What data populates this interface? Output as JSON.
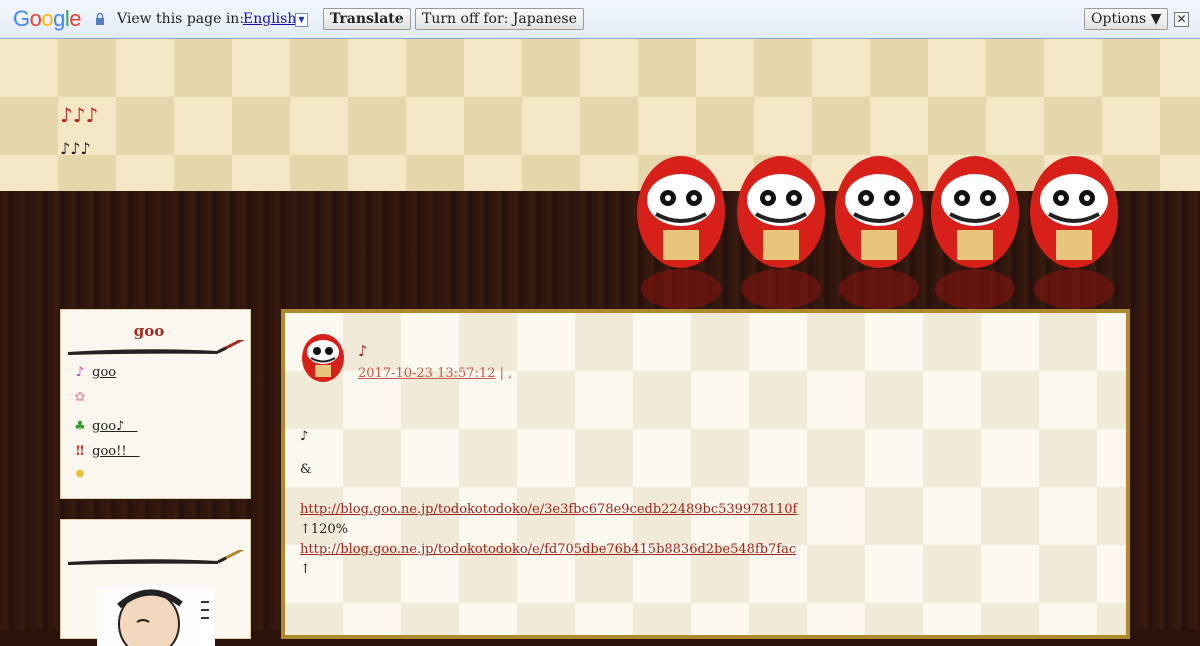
{
  "translate_bar": {
    "logo": "Google",
    "view_label": "View this page in:",
    "language": "English",
    "language_caret": "▼",
    "translate_button": "Translate",
    "turnoff_button": "Turn off for: Japanese",
    "options_button": "Options ▼",
    "close_button": "✕"
  },
  "header": {
    "title": "♪♪♪",
    "subtitle": "♪♪♪"
  },
  "sidebar": {
    "box1": {
      "title": "goo",
      "items": [
        {
          "icon": "♪",
          "label": "goo"
        },
        {
          "icon": "✿",
          "label": ""
        },
        {
          "icon": "♣",
          "label": "goo♪　"
        },
        {
          "icon": "‼",
          "label": "goo!!　"
        },
        {
          "icon": "●",
          "label": ""
        }
      ]
    }
  },
  "post": {
    "title": "♪",
    "date": "2017-10-23 13:57:12",
    "meta_sep": "| ,",
    "lines": [
      {
        "text": "♪"
      },
      {
        "text": "&"
      },
      {
        "text": "http://blog.goo.ne.jp/todokotodoko/e/3e3fbc678e9cedb22489bc539978110f"
      },
      {
        "text": "↑120%"
      },
      {
        "text": "http://blog.goo.ne.jp/todokotodoko/e/fd705dbe76b415b8836d2be548fb7fac"
      },
      {
        "text": "↑"
      }
    ]
  },
  "colors": {
    "accent_red": "#a02b1e",
    "frame_gold": "#b08a2f",
    "link": "#a0231a",
    "google_blue": "#4285f4",
    "google_red": "#ea4335",
    "google_yellow": "#fbbc05",
    "google_green": "#34a853"
  }
}
